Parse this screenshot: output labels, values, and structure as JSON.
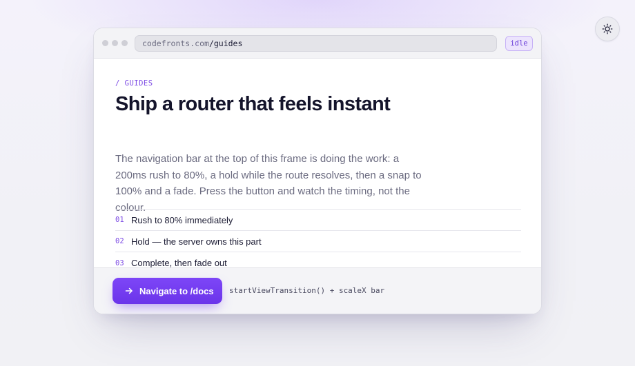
{
  "theme_toggle": {
    "icon": "sun-icon"
  },
  "browser": {
    "url": {
      "host": "codefronts.com",
      "path": "/guides"
    },
    "status": "idle"
  },
  "article": {
    "eyebrow": "/ GUIDES",
    "title": "Ship a router that feels instant",
    "lead": "The navigation bar at the top of this frame is doing the work: a 200ms rush to 80%, a hold while the route resolves, then a snap to 100% and a fade. Press the button and watch the timing, not the colour.",
    "steps": [
      {
        "num": "01",
        "label": "Rush to 80% immediately"
      },
      {
        "num": "02",
        "label": "Hold — the server owns this part"
      },
      {
        "num": "03",
        "label": "Complete, then fade out"
      }
    ]
  },
  "footer": {
    "button_label": "Navigate to /docs",
    "button_icon": "arrow-right-icon",
    "code_hint": "startViewTransition() + scaleX bar"
  },
  "colors": {
    "accent": "#7c4ae4",
    "button": "#6f38ee",
    "title": "#14142b",
    "muted": "#6b6b80"
  }
}
